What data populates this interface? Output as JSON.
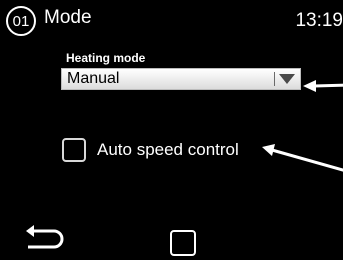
{
  "header": {
    "badge": "01",
    "title": "Mode",
    "time": "13:19"
  },
  "heating_mode": {
    "label": "Heating mode",
    "value": "Manual"
  },
  "auto_speed": {
    "label": "Auto speed control",
    "checked": false
  },
  "nav": {
    "back_icon": "back-arrow-icon",
    "home_icon": "home-square-icon"
  },
  "colors": {
    "screen_background": "#000000",
    "text": "#ffffff",
    "dropdown_background": "#f2f2f2"
  }
}
